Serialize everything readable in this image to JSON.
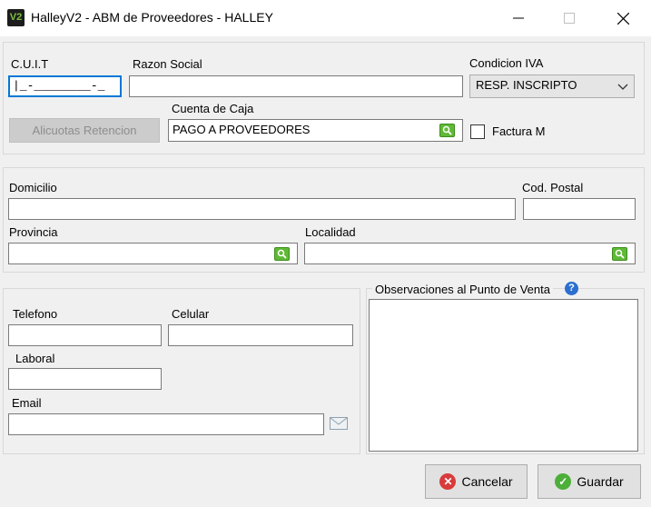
{
  "window": {
    "app_icon_text": "V2",
    "title": "HalleyV2 - ABM de Proveedores - HALLEY",
    "minimize_glyph": "─",
    "maximize_glyph": "☐",
    "close_glyph": "✕"
  },
  "company": {
    "cuit_label": "C.U.I.T",
    "cuit_value": "|_-________-_",
    "razon_social_label": "Razon Social",
    "razon_social_value": "",
    "condicion_iva_label": "Condicion IVA",
    "condicion_iva_value": "RESP. INSCRIPTO",
    "alicuotas_button": "Alicuotas Retencion",
    "cuenta_caja_label": "Cuenta de Caja",
    "cuenta_caja_value": "PAGO A PROVEEDORES",
    "factura_m_label": "Factura M",
    "factura_m_checked": false
  },
  "address": {
    "domicilio_label": "Domicilio",
    "domicilio_value": "",
    "cod_postal_label": "Cod. Postal",
    "cod_postal_value": "",
    "provincia_label": "Provincia",
    "provincia_value": "",
    "localidad_label": "Localidad",
    "localidad_value": ""
  },
  "contact": {
    "telefono_label": "Telefono",
    "telefono_value": "",
    "celular_label": "Celular",
    "celular_value": "",
    "laboral_label": "Laboral",
    "laboral_value": "",
    "email_label": "Email",
    "email_value": ""
  },
  "observaciones": {
    "label": "Observaciones al Punto de Venta",
    "help_glyph": "?",
    "value": ""
  },
  "actions": {
    "cancel_label": "Cancelar",
    "cancel_glyph": "✕",
    "save_label": "Guardar",
    "save_glyph": "✓"
  },
  "colors": {
    "focus": "#0078d7",
    "lookup_green": "#5fb936",
    "cancel_red": "#d83b3b",
    "save_green": "#4caf3a",
    "help_blue": "#2b6fd0"
  }
}
